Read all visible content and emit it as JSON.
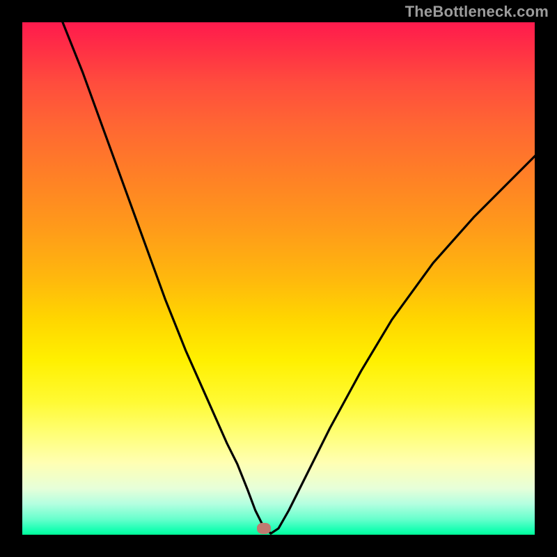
{
  "watermark": "TheBottleneck.com",
  "marker": {
    "x_frac": 0.472,
    "y_frac": 0.985
  },
  "chart_data": {
    "type": "line",
    "title": "",
    "xlabel": "",
    "ylabel": "",
    "xlim": [
      0,
      100
    ],
    "ylim": [
      0,
      100
    ],
    "legend": false,
    "grid": false,
    "series": [
      {
        "name": "bottleneck-curve",
        "x": [
          8,
          12,
          16,
          20,
          24,
          28,
          32,
          36,
          40,
          42,
          44,
          45.5,
          47,
          48.5,
          50,
          52,
          55,
          60,
          66,
          72,
          80,
          88,
          96,
          100
        ],
        "y": [
          100,
          90,
          79,
          68,
          57,
          46,
          36,
          27,
          18,
          14,
          9,
          5,
          2,
          0.5,
          1.5,
          5,
          11,
          21,
          32,
          42,
          53,
          62,
          70,
          74
        ]
      }
    ],
    "annotations": [
      {
        "type": "dot",
        "label": "optimal-point",
        "x": 47.2,
        "y": 1.5
      }
    ],
    "background_gradient": {
      "direction": "vertical",
      "colors_top_to_bottom": [
        "#ff1a4d",
        "#ff6633",
        "#ffd600",
        "#ffff73",
        "#e6ffd9",
        "#00ff99"
      ]
    }
  }
}
